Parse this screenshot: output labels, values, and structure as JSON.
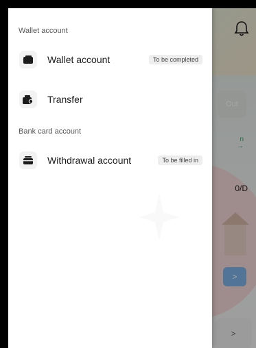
{
  "drawer": {
    "sections": [
      {
        "title": "Wallet account",
        "items": [
          {
            "label": "Wallet account",
            "badge": "To be completed",
            "icon": "wallet-icon"
          },
          {
            "label": "Transfer",
            "badge": "",
            "icon": "wallet-transfer-icon"
          }
        ]
      },
      {
        "title": "Bank card account",
        "items": [
          {
            "label": "Withdrawal account",
            "badge": "To be filled in",
            "icon": "card-stack-icon"
          }
        ]
      }
    ]
  },
  "background": {
    "partial_card_text": "Out",
    "partial_link_text": "n",
    "partial_arrow": "→",
    "partial_value": "0/D",
    "button_chevron": ">",
    "bottom_chevron": ">"
  },
  "colors": {
    "drawer_bg": "#ffffff",
    "badge_bg": "#eeeeee",
    "icon_bg": "#f2f2f2",
    "text_primary": "#1b1b1b",
    "section_title": "#555555",
    "accent_green": "#32a86d",
    "accent_blue": "#7fb3e6"
  }
}
